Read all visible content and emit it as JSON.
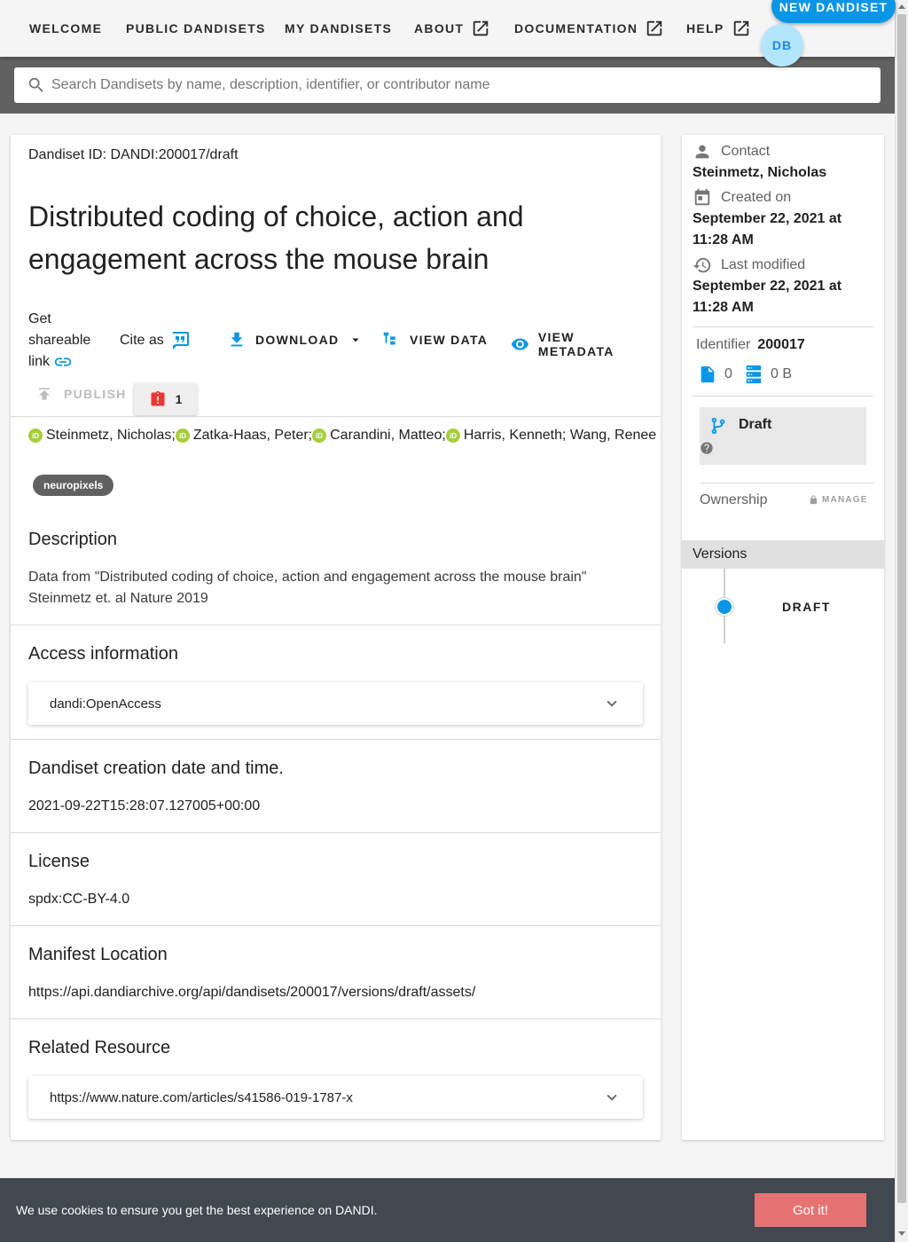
{
  "nav": {
    "items": [
      {
        "label": "WELCOME"
      },
      {
        "label": "PUBLIC DANDISETS"
      },
      {
        "label": "MY DANDISETS"
      },
      {
        "label": "ABOUT"
      },
      {
        "label": "DOCUMENTATION"
      },
      {
        "label": "HELP"
      }
    ],
    "new_dandiset_label": "NEW DANDISET",
    "avatar_initials": "DB"
  },
  "search": {
    "placeholder": "Search Dandisets by name, description, identifier, or contributor name",
    "value": ""
  },
  "dandiset": {
    "id_line": "Dandiset ID: DANDI:200017/draft",
    "title": "Distributed coding of choice, action and engagement across the mouse brain",
    "share_label": "Get shareable link",
    "cite_label": "Cite as",
    "download_label": "DOWNLOAD",
    "view_data_label": "VIEW DATA",
    "view_metadata_label": "VIEW METADATA",
    "publish_label": "PUBLISH",
    "error_count": "1",
    "contributors": [
      {
        "name": "Steinmetz, Nicholas;",
        "orcid": true
      },
      {
        "name": "Zatka-Haas, Peter;",
        "orcid": true
      },
      {
        "name": "Carandini, Matteo;",
        "orcid": true
      },
      {
        "name": "Harris, Kenneth; Wang, Renee",
        "orcid": true
      }
    ],
    "keyword": "neuropixels"
  },
  "sections": {
    "description": {
      "title": "Description",
      "text": "Data from \"Distributed coding of choice, action and engagement across the mouse brain\" Steinmetz et. al Nature 2019"
    },
    "access": {
      "title": "Access information",
      "panel": "dandi:OpenAccess"
    },
    "creation": {
      "title": "Dandiset creation date and time.",
      "value": "2021-09-22T15:28:07.127005+00:00"
    },
    "license": {
      "title": "License",
      "value": "spdx:CC-BY-4.0"
    },
    "manifest": {
      "title": "Manifest Location",
      "value": "https://api.dandiarchive.org/api/dandisets/200017/versions/draft/assets/"
    },
    "related": {
      "title": "Related Resource",
      "panel": "https://www.nature.com/articles/s41586-019-1787-x"
    }
  },
  "sidebar": {
    "contact_label": "Contact",
    "contact_value": "Steinmetz, Nicholas",
    "created_label": "Created on",
    "created_value": "September 22, 2021 at 11:28 AM",
    "modified_label": "Last modified",
    "modified_value": "September 22, 2021 at 11:28 AM",
    "identifier_label": "Identifier",
    "identifier_value": "200017",
    "file_count": "0",
    "size": "0 B",
    "draft_label": "Draft",
    "ownership_label": "Ownership",
    "manage_label": "MANAGE",
    "versions_label": "Versions",
    "version_draft": "DRAFT"
  },
  "cookie": {
    "text": "We use cookies to ensure you get the best experience on DANDI.",
    "button": "Got it!"
  },
  "colors": {
    "accent": "#0a96e6",
    "orcid": "#a6ce39",
    "error": "#e53935",
    "cookie_bg": "#424850",
    "cookie_btn": "#e57373"
  }
}
